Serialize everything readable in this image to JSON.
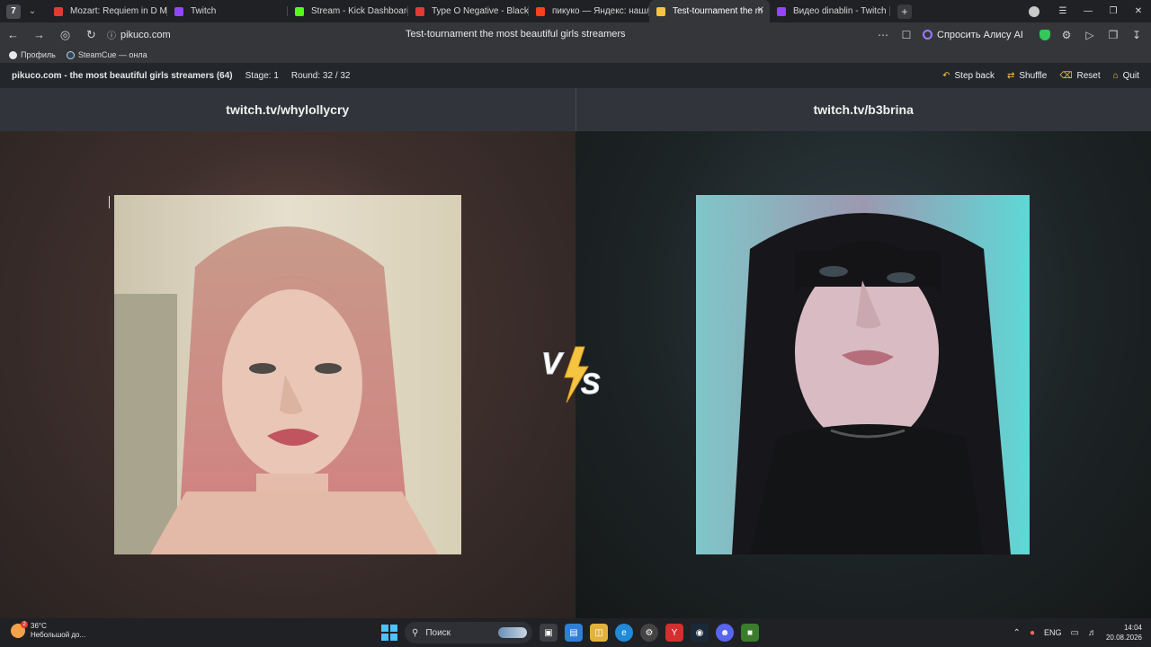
{
  "browser": {
    "tabs": [
      {
        "title": "Mozart: Requiem in D Minor",
        "favicon_color": "#e53935",
        "active": false
      },
      {
        "title": "Twitch",
        "favicon_color": "#9146ff",
        "active": false
      },
      {
        "title": "Stream - Kick Dashboard",
        "favicon_color": "#53fc18",
        "active": false
      },
      {
        "title": "Type O Negative - Black N",
        "favicon_color": "#e53935",
        "active": false
      },
      {
        "title": "пикуко — Яндекс: нашлось",
        "favicon_color": "#fc3f1d",
        "active": false
      },
      {
        "title": "Test-tournament the m",
        "favicon_color": "#f5c542",
        "active": true
      },
      {
        "title": "Видео dinablin - Twitch",
        "favicon_color": "#9146ff",
        "active": false
      }
    ],
    "address": {
      "domain": "pikuco.com",
      "page_title": "Test-tournament the most beautiful girls streamers"
    },
    "alice_label": "Спросить Алису AI",
    "bookmarks": [
      {
        "label": "Профиль"
      },
      {
        "label": "SteamCue — онла"
      }
    ]
  },
  "site": {
    "brand": "pikuco.com - the most beautiful girls streamers (64)",
    "stage": "Stage: 1",
    "round": "Round: 32 / 32",
    "actions": {
      "step_back": "Step back",
      "shuffle": "Shuffle",
      "reset": "Reset",
      "quit": "Quit"
    },
    "contestants": {
      "left": {
        "name": "twitch.tv/whylollycry"
      },
      "right": {
        "name": "twitch.tv/b3brina"
      }
    }
  },
  "taskbar": {
    "weather_temp": "36°C",
    "weather_desc": "Небольшой до...",
    "weather_badge": "2",
    "search_placeholder": "Поиск",
    "lang": "ENG",
    "time": "14:04",
    "date": "20.08.2026"
  }
}
